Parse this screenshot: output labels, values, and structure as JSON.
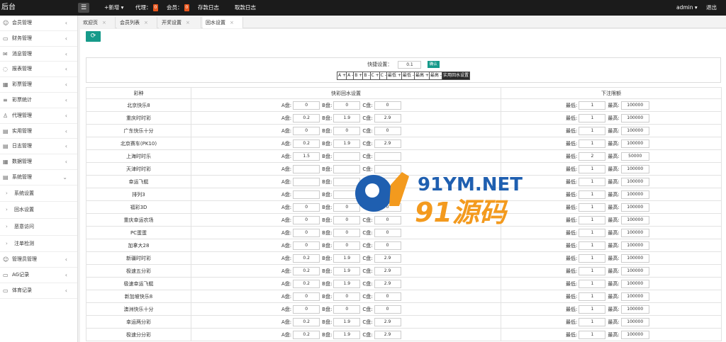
{
  "brand": "后台",
  "topbar": {
    "add_label": "+新增 ▾",
    "agent_label": "代理：",
    "agent_count": "0",
    "member_label": "会员：",
    "member_count": "0",
    "deposit_log": "存款日志",
    "withdraw_log": "取款日志",
    "user": "admin ▾",
    "logout": "退出"
  },
  "sidebar": {
    "items": [
      {
        "label": "会员管理"
      },
      {
        "label": "财务管理"
      },
      {
        "label": "消息管理"
      },
      {
        "label": "报表管理"
      },
      {
        "label": "彩票管理"
      },
      {
        "label": "彩票统计"
      },
      {
        "label": "代理管理"
      },
      {
        "label": "实用管理"
      },
      {
        "label": "日志管理"
      },
      {
        "label": "数据管理"
      },
      {
        "label": "系统管理"
      }
    ],
    "sub_items": [
      {
        "label": "系统设置"
      },
      {
        "label": "回水设置"
      },
      {
        "label": "恶意访问"
      },
      {
        "label": "注单检测"
      }
    ],
    "bottom_items": [
      {
        "label": "管理员管理"
      },
      {
        "label": "AG记录"
      },
      {
        "label": "体育记录"
      }
    ]
  },
  "tabs": [
    {
      "label": "欢迎页"
    },
    {
      "label": "会员列表"
    },
    {
      "label": "开奖设置"
    },
    {
      "label": "回水设置"
    }
  ],
  "quick": {
    "label": "快捷设置：",
    "value": "0.1",
    "confirm": "确认",
    "buttons": [
      "A +",
      "A -",
      "B +",
      "B -",
      "C +",
      "C -",
      "最低 +",
      "最低 -",
      "最高 +",
      "最高 -",
      "实用回水设置"
    ]
  },
  "table": {
    "headers": [
      "彩种",
      "快彩回水设置",
      "下注限额"
    ],
    "label_a": "A盘:",
    "label_b": "B盘:",
    "label_c": "C盘:",
    "label_min": "最低:",
    "label_max": "最高:",
    "rows": [
      {
        "name": "北京快乐8",
        "a": "0",
        "b": "0",
        "c": "0",
        "min": "1",
        "max": "100000"
      },
      {
        "name": "重庆时时彩",
        "a": "0.2",
        "b": "1.9",
        "c": "2.9",
        "min": "1",
        "max": "100000"
      },
      {
        "name": "广东快乐十分",
        "a": "0",
        "b": "0",
        "c": "0",
        "min": "1",
        "max": "100000"
      },
      {
        "name": "北京赛车(PK10)",
        "a": "0.2",
        "b": "1.9",
        "c": "2.9",
        "min": "1",
        "max": "100000"
      },
      {
        "name": "上海时时乐",
        "a": "1.5",
        "b": "",
        "c": "",
        "min": "2",
        "max": "50000"
      },
      {
        "name": "天津时时彩",
        "a": "",
        "b": "",
        "c": "",
        "min": "1",
        "max": "100000"
      },
      {
        "name": "幸运飞艇",
        "a": "",
        "b": "",
        "c": "",
        "min": "1",
        "max": "100000"
      },
      {
        "name": "排列3",
        "a": "",
        "b": "",
        "c": "",
        "min": "1",
        "max": "100000"
      },
      {
        "name": "福彩3D",
        "a": "0",
        "b": "0",
        "c": "0",
        "min": "1",
        "max": "100000"
      },
      {
        "name": "重庆幸运农场",
        "a": "0",
        "b": "0",
        "c": "0",
        "min": "1",
        "max": "100000"
      },
      {
        "name": "PC蛋蛋",
        "a": "0",
        "b": "0",
        "c": "0",
        "min": "1",
        "max": "100000"
      },
      {
        "name": "加拿大28",
        "a": "0",
        "b": "0",
        "c": "0",
        "min": "1",
        "max": "100000"
      },
      {
        "name": "新疆时时彩",
        "a": "0.2",
        "b": "1.9",
        "c": "2.9",
        "min": "1",
        "max": "100000"
      },
      {
        "name": "极速五分彩",
        "a": "0.2",
        "b": "1.9",
        "c": "2.9",
        "min": "1",
        "max": "100000"
      },
      {
        "name": "极速幸运飞艇",
        "a": "0.2",
        "b": "1.9",
        "c": "2.9",
        "min": "1",
        "max": "100000"
      },
      {
        "name": "新加坡快乐8",
        "a": "0",
        "b": "0",
        "c": "0",
        "min": "1",
        "max": "100000"
      },
      {
        "name": "澳洲快乐十分",
        "a": "0",
        "b": "0",
        "c": "0",
        "min": "1",
        "max": "100000"
      },
      {
        "name": "幸运两分彩",
        "a": "0.2",
        "b": "1.9",
        "c": "2.9",
        "min": "1",
        "max": "100000"
      },
      {
        "name": "极速分分彩",
        "a": "0.2",
        "b": "1.9",
        "c": "2.9",
        "min": "1",
        "max": "100000"
      }
    ]
  },
  "watermark": {
    "line1": "91YM.NET",
    "line2": "91源码"
  }
}
